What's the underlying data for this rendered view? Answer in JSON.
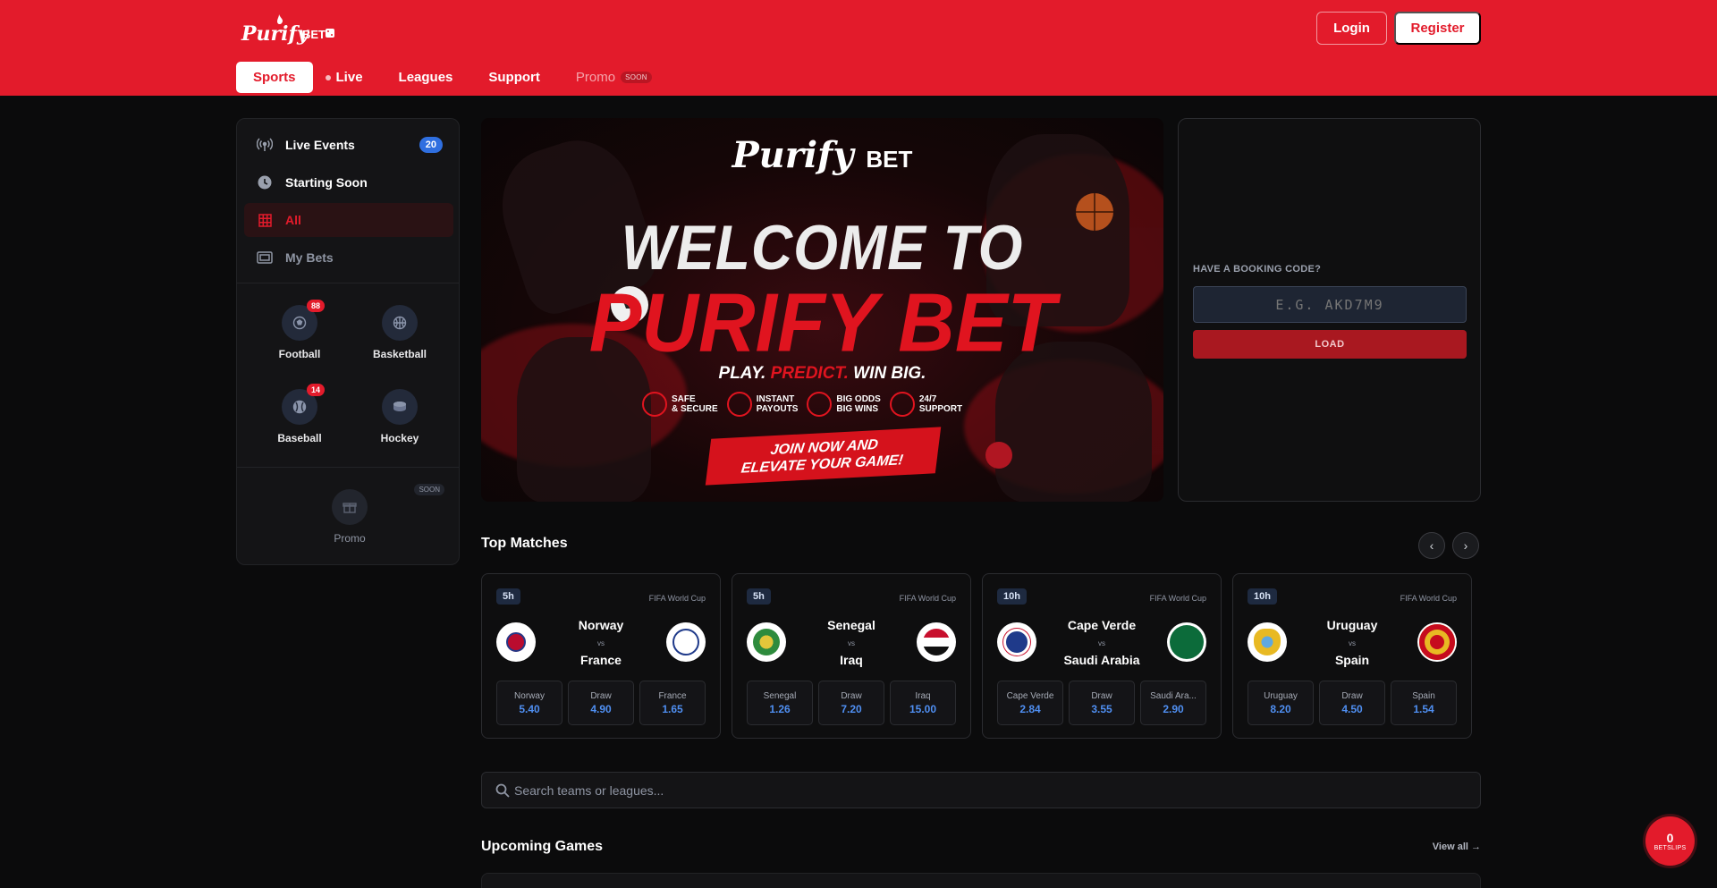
{
  "header": {
    "logo_text": "PurifyBET",
    "login_label": "Login",
    "register_label": "Register",
    "nav": [
      {
        "label": "Sports"
      },
      {
        "label": "Live"
      },
      {
        "label": "Leagues"
      },
      {
        "label": "Support"
      },
      {
        "label": "Promo",
        "badge": "SOON"
      }
    ]
  },
  "sidebar": {
    "items": [
      {
        "label": "Live Events",
        "count": "20",
        "icon": "broadcast-icon"
      },
      {
        "label": "Starting Soon",
        "icon": "clock-icon"
      },
      {
        "label": "All",
        "icon": "grid-icon"
      },
      {
        "label": "My Bets",
        "icon": "ticket-icon"
      }
    ],
    "sports": [
      {
        "label": "Football",
        "count": "88",
        "icon": "football-icon"
      },
      {
        "label": "Basketball",
        "icon": "basketball-icon"
      },
      {
        "label": "Baseball",
        "count": "14",
        "icon": "baseball-icon"
      },
      {
        "label": "Hockey",
        "icon": "hockey-icon"
      }
    ],
    "promo": {
      "label": "Promo",
      "badge": "SOON",
      "icon": "gift-icon"
    }
  },
  "banner": {
    "logo_script": "Purify",
    "logo_bet": "BET",
    "welcome": "WELCOME TO",
    "brand": "PURIFY BET",
    "tagline_play": "PLAY.",
    "tagline_predict": "PREDICT.",
    "tagline_win": "WIN BIG.",
    "features": [
      {
        "line1": "SAFE",
        "line2": "& SECURE"
      },
      {
        "line1": "INSTANT",
        "line2": "PAYOUTS"
      },
      {
        "line1": "BIG ODDS",
        "line2": "BIG WINS"
      },
      {
        "line1": "24/7",
        "line2": "SUPPORT"
      }
    ],
    "cta_line1": "JOIN NOW AND",
    "cta_line2": "ELEVATE YOUR GAME!"
  },
  "booking": {
    "label": "HAVE A BOOKING CODE?",
    "placeholder": "E.G. AKD7M9",
    "load_label": "LOAD"
  },
  "top_matches": {
    "title": "Top Matches",
    "prev_icon": "chevron-left-icon",
    "next_icon": "chevron-right-icon",
    "matches": [
      {
        "time": "5h",
        "league": "FIFA World Cup",
        "home": "Norway",
        "away": "France",
        "vs": "vs",
        "odds": [
          {
            "label": "Norway",
            "value": "5.40"
          },
          {
            "label": "Draw",
            "value": "4.90"
          },
          {
            "label": "France",
            "value": "1.65"
          }
        ],
        "home_color": "#ba0c2f",
        "away_color": "#1f3a8a"
      },
      {
        "time": "5h",
        "league": "FIFA World Cup",
        "home": "Senegal",
        "away": "Iraq",
        "vs": "vs",
        "odds": [
          {
            "label": "Senegal",
            "value": "1.26"
          },
          {
            "label": "Draw",
            "value": "7.20"
          },
          {
            "label": "Iraq",
            "value": "15.00"
          }
        ],
        "home_color": "#2e8b3d",
        "away_color": "#c8102e"
      },
      {
        "time": "10h",
        "league": "FIFA World Cup",
        "home": "Cape Verde",
        "away": "Saudi Arabia",
        "vs": "vs",
        "odds": [
          {
            "label": "Cape Verde",
            "value": "2.84"
          },
          {
            "label": "Draw",
            "value": "3.55"
          },
          {
            "label": "Saudi Ara...",
            "value": "2.90"
          }
        ],
        "home_color": "#1f3a8a",
        "away_color": "#0c6b3a"
      },
      {
        "time": "10h",
        "league": "FIFA World Cup",
        "home": "Uruguay",
        "away": "Spain",
        "vs": "vs",
        "odds": [
          {
            "label": "Uruguay",
            "value": "8.20"
          },
          {
            "label": "Draw",
            "value": "4.50"
          },
          {
            "label": "Spain",
            "value": "1.54"
          }
        ],
        "home_color": "#e8b923",
        "away_color": "#c60b1e"
      }
    ]
  },
  "search": {
    "placeholder": "Search teams or leagues..."
  },
  "upcoming": {
    "title": "Upcoming Games",
    "view_all": "View all →"
  },
  "betslip": {
    "count": "0",
    "label": "BETSLIPS"
  },
  "colors": {
    "brand_red": "#e31b2b",
    "odds_blue": "#4f8ff2",
    "badge_blue": "#2f6fe0"
  }
}
